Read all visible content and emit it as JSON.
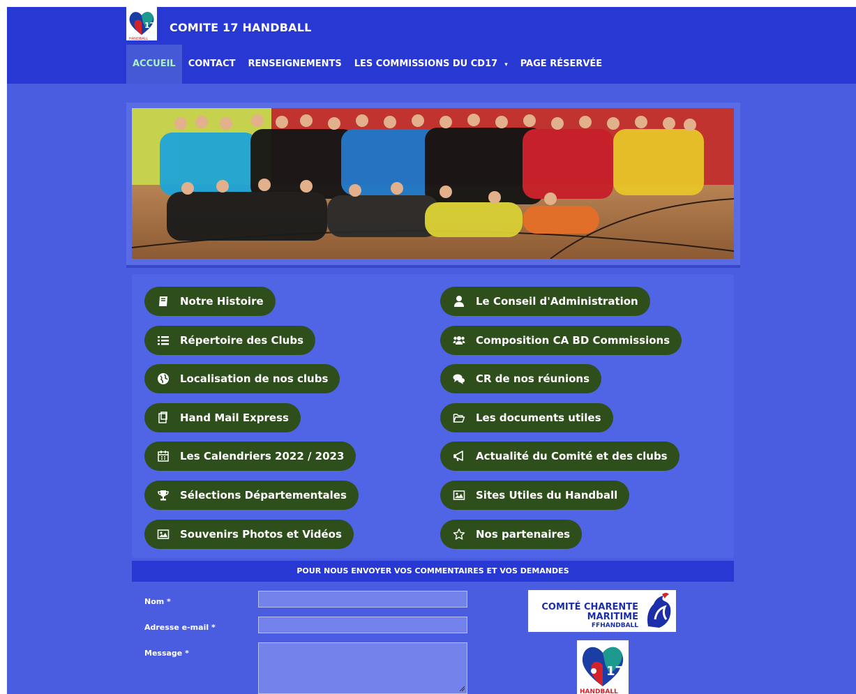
{
  "site": {
    "title": "COMITE 17 HANDBALL"
  },
  "nav": [
    {
      "label": "ACCUEIL",
      "active": true
    },
    {
      "label": "CONTACT"
    },
    {
      "label": "RENSEIGNEMENTS"
    },
    {
      "label": "LES COMMISSIONS DU CD17",
      "caret": "▾"
    },
    {
      "label": "PAGE RÉSERVÉE"
    }
  ],
  "buttons_left": [
    {
      "label": "Notre Histoire",
      "icon": "book-icon"
    },
    {
      "label": "Répertoire des Clubs",
      "icon": "list-icon"
    },
    {
      "label": "Localisation de nos clubs",
      "icon": "globe-icon"
    },
    {
      "label": "Hand Mail Express",
      "icon": "clipboard-icon"
    },
    {
      "label": "Les Calendriers 2022 / 2023",
      "icon": "calendar-icon"
    },
    {
      "label": "Sélections Départementales",
      "icon": "trophy-icon"
    },
    {
      "label": "Souvenirs Photos et Vidéos",
      "icon": "image-icon"
    }
  ],
  "buttons_right": [
    {
      "label": "Le Conseil d'Administration",
      "icon": "user-icon"
    },
    {
      "label": "Composition CA BD Commissions",
      "icon": "users-icon"
    },
    {
      "label": "CR de nos réunions",
      "icon": "comments-icon"
    },
    {
      "label": "Les documents utiles",
      "icon": "folder-open-icon"
    },
    {
      "label": "Actualité du Comité et des clubs",
      "icon": "megaphone-icon"
    },
    {
      "label": "Sites Utiles du Handball",
      "icon": "image-icon"
    },
    {
      "label": "Nos partenaires",
      "icon": "star-icon"
    }
  ],
  "form": {
    "heading": "POUR NOUS ENVOYER VOS COMMENTAIRES ET VOS DEMANDES",
    "name_label": "Nom *",
    "email_label": "Adresse e-mail *",
    "message_label": "Message *"
  },
  "partner": {
    "line1": "COMITÉ CHARENTE",
    "line2": "MARITIME",
    "line3": "FFHANDBALL"
  },
  "colors": {
    "header": "#2839d3",
    "page": "#4a5de0",
    "button": "#2e4f1b",
    "active_nav_text": "#a9f0c6"
  }
}
